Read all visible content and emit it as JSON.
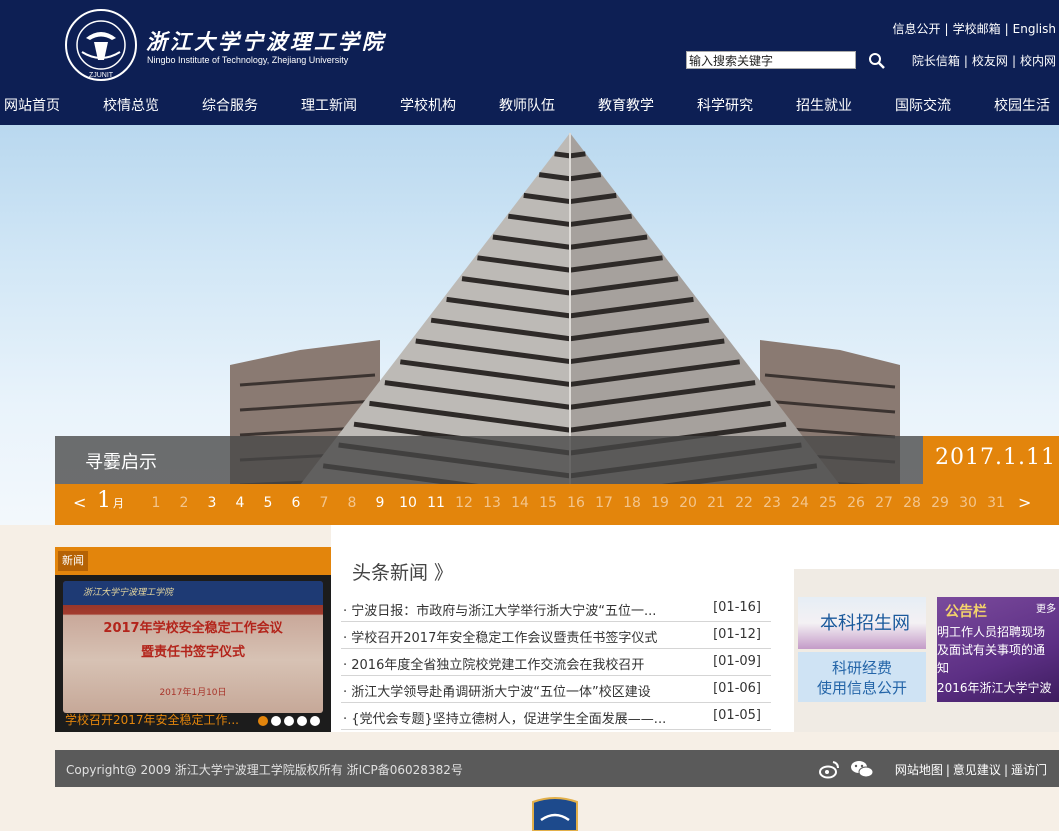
{
  "header": {
    "school_name_cn": "浙江大学宁波理工学院",
    "school_name_en": "Ningbo Institute of Technology, Zhejiang University",
    "top_links": [
      "信息公开",
      "学校邮箱",
      "English"
    ],
    "search": {
      "value": "输入搜索关键字"
    },
    "sub_links": [
      "院长信箱",
      "校友网",
      "校内网"
    ]
  },
  "nav": {
    "items": [
      "网站首页",
      "校情总览",
      "综合服务",
      "理工新闻",
      "学校机构",
      "教师队伍",
      "教育教学",
      "科学研究",
      "招生就业",
      "国际交流",
      "校园生活"
    ]
  },
  "banner": {
    "caption": "寻霎启示",
    "date": "2017.1.11",
    "month_num": "1",
    "month_unit": "月",
    "prev": "<",
    "next": ">",
    "days": [
      "1",
      "2",
      "3",
      "4",
      "5",
      "6",
      "7",
      "8",
      "9",
      "10",
      "11",
      "12",
      "13",
      "14",
      "15",
      "16",
      "17",
      "18",
      "19",
      "20",
      "21",
      "22",
      "23",
      "24",
      "25",
      "26",
      "27",
      "28",
      "29",
      "30",
      "31"
    ],
    "active_days": [
      3,
      4,
      5,
      6,
      9,
      10,
      11
    ]
  },
  "news_photo": {
    "tag": "新闻",
    "slide_banner_text": "浙江大学宁波理工学院",
    "slide_title_1": "2017年学校安全稳定工作会议",
    "slide_title_2": "暨责任书签字仪式",
    "slide_date": "2017年1月10日",
    "caption": "学校召开2017年安全稳定工作..."
  },
  "headline": {
    "title": "头条新闻 》",
    "items": [
      {
        "title": "· 宁波日报：市政府与浙江大学举行浙大宁波“五位一...",
        "date": "[01-16]"
      },
      {
        "title": "· 学校召开2017年安全稳定工作会议暨责任书签字仪式",
        "date": "[01-12]"
      },
      {
        "title": "· 2016年度全省独立院校党建工作交流会在我校召开",
        "date": "[01-09]"
      },
      {
        "title": "· 浙江大学领导赴甬调研浙大宁波“五位一体”校区建设",
        "date": "[01-06]"
      },
      {
        "title": "· {党代会专题}坚持立德树人，促进学生全面发展——...",
        "date": "[01-05]"
      }
    ]
  },
  "tiles": {
    "admission": "本科招生网",
    "funding_1": "科研经费",
    "funding_2": "使用信息公开",
    "notice_title": "公告栏",
    "notice_more": "更多",
    "notice_lines": [
      "明工作人员招聘现场",
      "及面试有关事项的通",
      "知",
      "2016年浙江大学宁波"
    ]
  },
  "footer": {
    "copyright": "Copyright@ 2009 浙江大学宁波理工学院版权所有 浙ICP备06028382号",
    "links": [
      "网站地图",
      "意见建议",
      "遥访门"
    ]
  }
}
